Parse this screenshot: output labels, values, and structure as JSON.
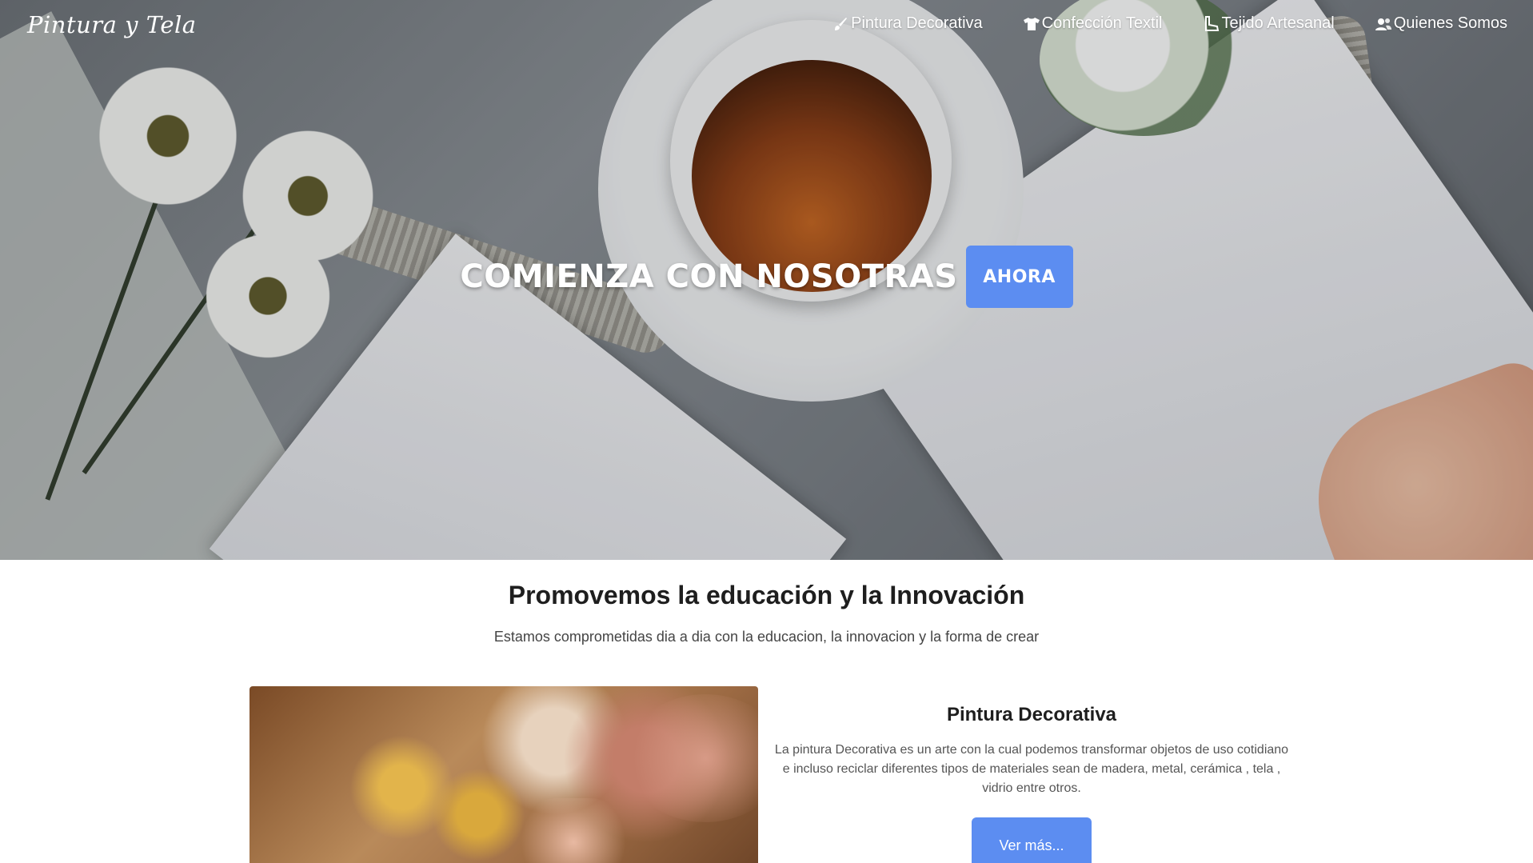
{
  "brand": {
    "name": "Pintura y Tela"
  },
  "nav": {
    "items": [
      {
        "label": "Pintura Decorativa",
        "icon": "paintbrush-icon"
      },
      {
        "label": "Confección Textil",
        "icon": "tshirt-icon"
      },
      {
        "label": "Tejido Artesanal",
        "icon": "boot-icon"
      },
      {
        "label": "Quienes Somos",
        "icon": "users-icon"
      }
    ]
  },
  "hero": {
    "title": "COMIENZA CON NOSOTRAS",
    "button_label": "AHORA"
  },
  "intro": {
    "title": "Promovemos la educación y la Innovación",
    "subtitle": "Estamos comprometidas dia a dia con la educacion, la innovacion y la forma de crear"
  },
  "feature": {
    "title": "Pintura Decorativa",
    "text": "La pintura Decorativa es un arte con la cual podemos transformar objetos de uso cotidiano e incluso reciclar diferentes tipos de materiales sean de madera, metal, cerámica , tela , vidrio entre otros.",
    "button_label": "Ver más..."
  },
  "colors": {
    "accent": "#5c8df1",
    "text_dark": "#1e1e1e",
    "text_muted": "#555555"
  }
}
